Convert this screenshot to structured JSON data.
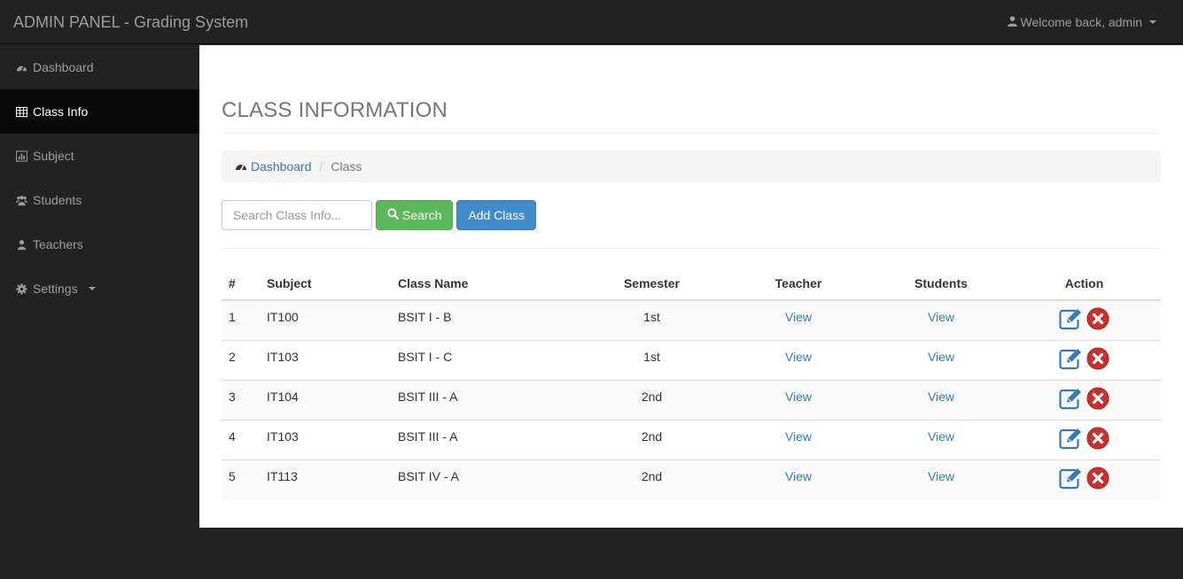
{
  "header": {
    "brand": "ADMIN PANEL - Grading System",
    "user_greeting": "Welcome back, admin"
  },
  "sidebar": {
    "items": [
      {
        "label": "Dashboard",
        "icon": "dashboard-icon"
      },
      {
        "label": "Class Info",
        "icon": "table-icon"
      },
      {
        "label": "Subject",
        "icon": "bar-chart-icon"
      },
      {
        "label": "Students",
        "icon": "users-icon"
      },
      {
        "label": "Teachers",
        "icon": "user-icon"
      },
      {
        "label": "Settings",
        "icon": "gear-icon"
      }
    ],
    "active_index": 1
  },
  "main": {
    "title": "CLASS INFORMATION",
    "breadcrumb": {
      "home": "Dashboard",
      "current": "Class"
    },
    "search": {
      "placeholder": "Search Class Info...",
      "value": ""
    },
    "buttons": {
      "search": "Search",
      "add_class": "Add Class"
    },
    "table": {
      "headers": [
        "#",
        "Subject",
        "Class Name",
        "Semester",
        "Teacher",
        "Students",
        "Action"
      ],
      "rows": [
        {
          "num": "1",
          "subject": "IT100",
          "class_name": "BSIT I - B",
          "semester": "1st",
          "teacher": "View",
          "students": "View"
        },
        {
          "num": "2",
          "subject": "IT103",
          "class_name": "BSIT I - C",
          "semester": "1st",
          "teacher": "View",
          "students": "View"
        },
        {
          "num": "3",
          "subject": "IT104",
          "class_name": "BSIT III - A",
          "semester": "2nd",
          "teacher": "View",
          "students": "View"
        },
        {
          "num": "4",
          "subject": "IT103",
          "class_name": "BSIT III - A",
          "semester": "2nd",
          "teacher": "View",
          "students": "View"
        },
        {
          "num": "5",
          "subject": "IT113",
          "class_name": "BSIT IV - A",
          "semester": "2nd",
          "teacher": "View",
          "students": "View"
        }
      ]
    }
  },
  "colors": {
    "navbar": "#222222",
    "link": "#337ab7",
    "success": "#5cb85c",
    "primary": "#428bca",
    "delete": "#c9302c"
  }
}
